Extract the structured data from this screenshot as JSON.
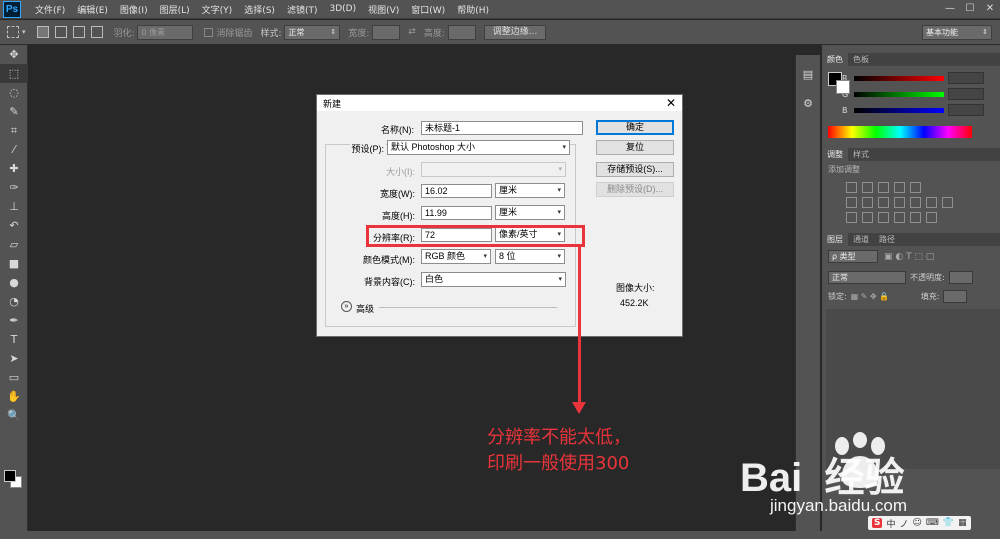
{
  "menubar": {
    "logo": "Ps",
    "items": [
      "文件(F)",
      "编辑(E)",
      "图像(I)",
      "图层(L)",
      "文字(Y)",
      "选择(S)",
      "滤镜(T)",
      "3D(D)",
      "视图(V)",
      "窗口(W)",
      "帮助(H)"
    ],
    "win_min": "—",
    "win_max": "☐",
    "win_close": "✕"
  },
  "options": {
    "feather_label": "羽化:",
    "feather_value": "0 像素",
    "antialias": "消除锯齿",
    "style_label": "样式:",
    "style_value": "正常",
    "width_label": "宽度:",
    "height_label": "高度:",
    "refine_button": "调整边缘...",
    "workspace": "基本功能"
  },
  "panels": {
    "tab_color": "颜色",
    "tab_swatches": "色板",
    "r": "R",
    "g": "G",
    "b": "B",
    "tab_adjust": "调整",
    "tab_styles": "样式",
    "adjust_hint": "添加调整",
    "tab_layers": "图层",
    "tab_channels": "通道",
    "tab_paths": "路径",
    "kind": "ρ 类型",
    "blend": "正常",
    "opacity_label": "不透明度:",
    "lock_label": "锁定:",
    "fill_label": "填充:"
  },
  "dialog": {
    "title": "新建",
    "close": "✕",
    "name_label": "名称(N):",
    "name_value": "未标题-1",
    "preset_label": "预设(P):",
    "preset_value": "默认 Photoshop 大小",
    "size_label": "大小(I):",
    "width_label": "宽度(W):",
    "width_value": "16.02",
    "width_unit": "厘米",
    "height_label": "高度(H):",
    "height_value": "11.99",
    "height_unit": "厘米",
    "res_label": "分辨率(R):",
    "res_value": "72",
    "res_unit": "像素/英寸",
    "mode_label": "颜色模式(M):",
    "mode_value": "RGB 颜色",
    "depth_value": "8 位",
    "bg_label": "背景内容(C):",
    "bg_value": "白色",
    "advanced": "高级",
    "ok": "确定",
    "reset": "复位",
    "save_preset": "存储预设(S)...",
    "delete_preset": "删除预设(D)...",
    "image_size_label": "图像大小:",
    "image_size_value": "452.2K"
  },
  "annotation": {
    "line1": "分辨率不能太低，",
    "line2": "印刷一般使用300"
  },
  "watermark": {
    "logo": "Bai  经验",
    "url": "jingyan.baidu.com"
  },
  "ime": {
    "items": [
      "S",
      "中",
      "ノ",
      "☺",
      "⌨",
      "👕",
      "▦"
    ]
  },
  "colors": {
    "annotation_red": "#e8343a",
    "ui_dark": "#282828",
    "panel": "#535353",
    "ok_border": "#0078d7"
  }
}
